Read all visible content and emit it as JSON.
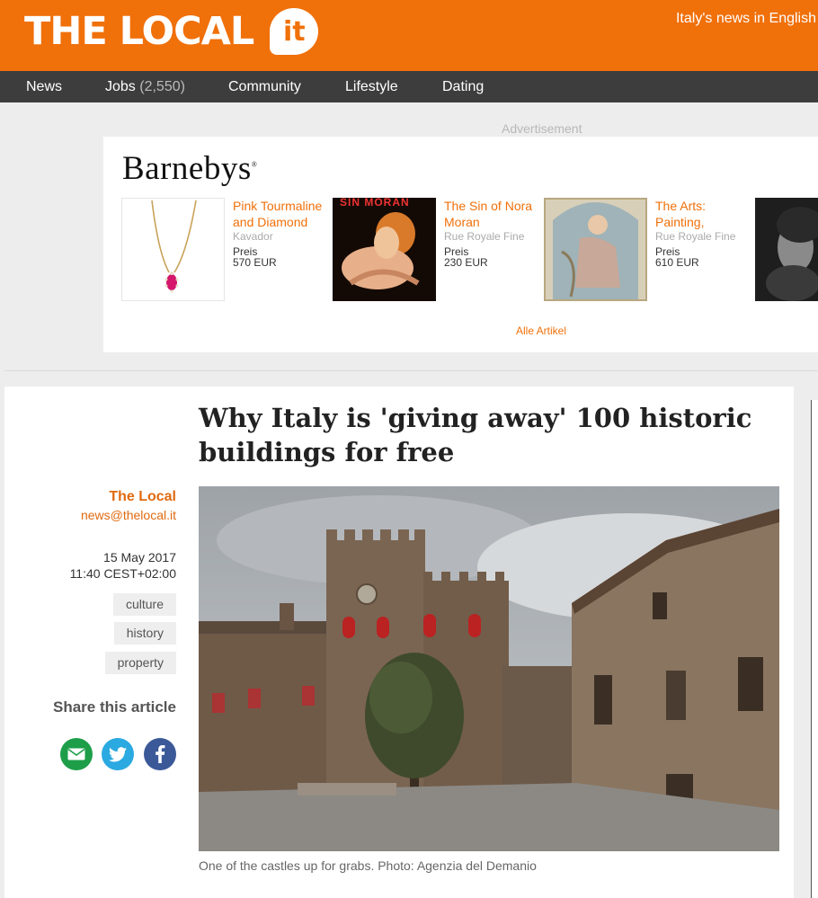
{
  "header": {
    "logo_text": "THE LOCAL",
    "logo_badge": "it",
    "tagline": "Italy's news in English"
  },
  "nav": {
    "news": "News",
    "jobs": "Jobs",
    "jobs_count": "(2,550)",
    "community": "Community",
    "lifestyle": "Lifestyle",
    "dating": "Dating"
  },
  "ad": {
    "label": "Advertisement",
    "brand": "Barnebys",
    "brand_mark": "®",
    "items": [
      {
        "title": "Pink Tourmaline and Diamond",
        "seller": "Kavador",
        "price_label": "Preis",
        "price": "570 EUR"
      },
      {
        "title": "The Sin of Nora Moran",
        "seller": "Rue Royale Fine",
        "price_label": "Preis",
        "price": "230 EUR",
        "poster_text": "SIN MORAN"
      },
      {
        "title": "The Arts: Painting,",
        "seller": "Rue Royale Fine",
        "price_label": "Preis",
        "price": "610 EUR"
      }
    ],
    "all_link": "Alle Artikel"
  },
  "article": {
    "headline": "Why Italy is 'giving away' 100 historic buildings for free",
    "author": "The Local",
    "email": "news@thelocal.it",
    "date": "15 May 2017",
    "time": "11:40 CEST+02:00",
    "tags": [
      "culture",
      "history",
      "property"
    ],
    "share_title": "Share this article",
    "caption": "One of the castles up for grabs. Photo: Agenzia del Demanio"
  },
  "colors": {
    "brand_orange": "#f0700a",
    "nav_bg": "#3d3d3d",
    "email_green": "#1e9e48",
    "twitter_blue": "#2ba9e1",
    "facebook_blue": "#3b5998"
  },
  "icons": {
    "email": "envelope-icon",
    "twitter": "twitter-bird-icon",
    "facebook": "facebook-f-icon"
  }
}
